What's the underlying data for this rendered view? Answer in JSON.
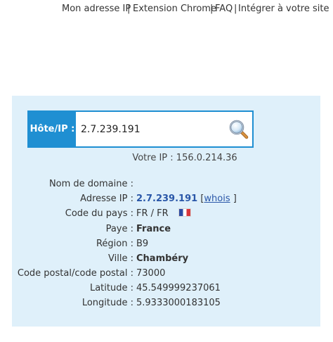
{
  "nav": {
    "items": [
      "Mon adresse IP",
      "Extension Chrome",
      "FAQ",
      "Intégrer à votre site"
    ],
    "separator": "|"
  },
  "search": {
    "label": "Hôte/IP :",
    "value": "2.7.239.191",
    "button_icon": "magnifier-icon"
  },
  "your_ip": {
    "label": "Votre IP :",
    "value": "156.0.214.36"
  },
  "details": {
    "domain_label": "Nom de domaine :",
    "domain_value": "",
    "ip_label": "Adresse IP :",
    "ip_value": "2.7.239.191",
    "whois_open": "[",
    "whois_label": "whois",
    "whois_close": "]",
    "country_code_label": "Code du pays :",
    "country_code_value": "FR / FR",
    "country_flag_icon": "france-flag-icon",
    "country_label": "Paye :",
    "country_value": "France",
    "region_label": "Région :",
    "region_value": "B9",
    "city_label": "Ville :",
    "city_value": "Chambéry",
    "postal_label": "Code postal/code postal :",
    "postal_value": "73000",
    "latitude_label": "Latitude :",
    "latitude_value": "45.549999237061",
    "longitude_label": "Longitude :",
    "longitude_value": "5.9333000183105"
  },
  "colors": {
    "accent": "#1f8fd2",
    "panel_bg": "#dff0fa",
    "link": "#2a57a8"
  }
}
